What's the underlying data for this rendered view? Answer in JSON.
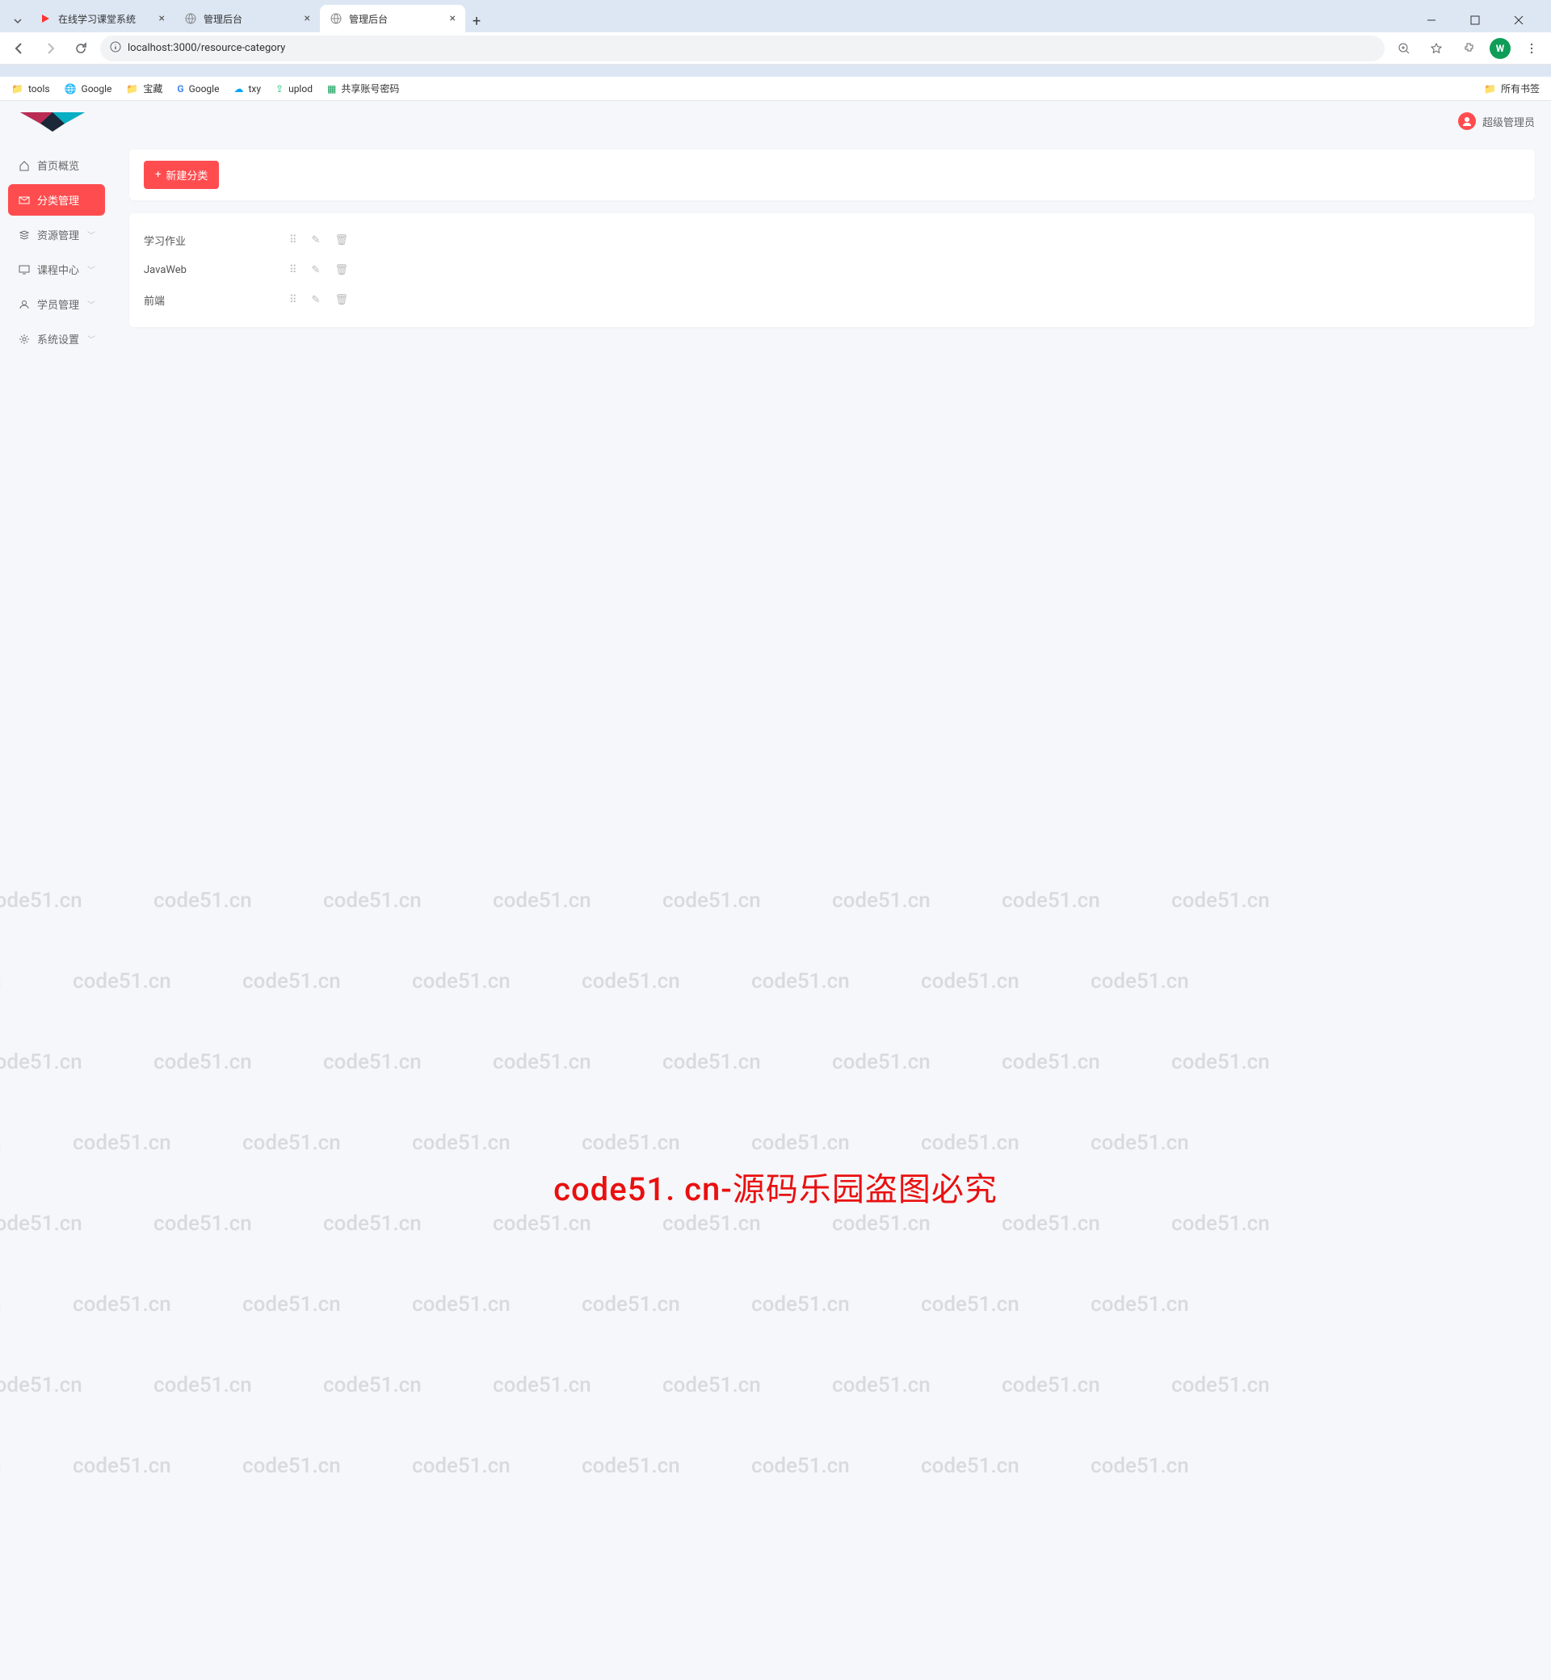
{
  "browser": {
    "tabs": [
      {
        "title": "在线学习课堂系统",
        "favicon": "red-play",
        "active": false
      },
      {
        "title": "管理后台",
        "favicon": "globe",
        "active": false
      },
      {
        "title": "管理后台",
        "favicon": "globe",
        "active": true
      }
    ],
    "url": "localhost:3000/resource-category",
    "avatar_letter": "W",
    "bookmarks": [
      {
        "label": "tools",
        "icon": "folder"
      },
      {
        "label": "Google",
        "icon": "globe"
      },
      {
        "label": "宝藏",
        "icon": "folder"
      },
      {
        "label": "Google",
        "icon": "google"
      },
      {
        "label": "txy",
        "icon": "cloud"
      },
      {
        "label": "uplod",
        "icon": "upload"
      },
      {
        "label": "共享账号密码",
        "icon": "sheet"
      }
    ],
    "all_bookmarks": "所有书签"
  },
  "app": {
    "user_name": "超级管理员",
    "sidebar": {
      "items": [
        {
          "label": "首页概览",
          "icon": "home",
          "expandable": false
        },
        {
          "label": "分类管理",
          "icon": "mail",
          "expandable": false,
          "active": true
        },
        {
          "label": "资源管理",
          "icon": "stack",
          "expandable": true
        },
        {
          "label": "课程中心",
          "icon": "monitor",
          "expandable": true
        },
        {
          "label": "学员管理",
          "icon": "person",
          "expandable": true
        },
        {
          "label": "系统设置",
          "icon": "gear",
          "expandable": true
        }
      ]
    },
    "toolbar": {
      "new_category_label": "新建分类"
    },
    "categories": [
      {
        "name": "学习作业"
      },
      {
        "name": "JavaWeb"
      },
      {
        "name": "前端"
      }
    ]
  },
  "watermark": {
    "repeat": "code51.cn",
    "center": "code51. cn-源码乐园盗图必究"
  }
}
